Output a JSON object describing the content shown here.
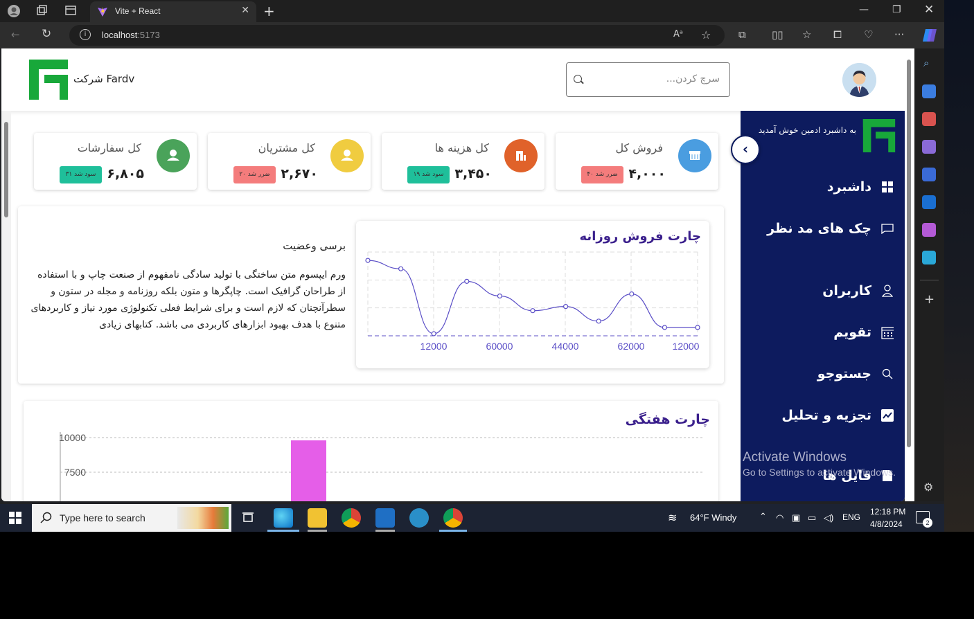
{
  "browser": {
    "tab_title": "Vite + React",
    "url_host": "localhost",
    "url_port": ":5173"
  },
  "header": {
    "company": "شرکت Fardv",
    "search_placeholder": "...سرچ کردن"
  },
  "sidebar": {
    "welcome": "به داشبرد ادمین خوش آمدید",
    "items": [
      {
        "label": "داشبرد",
        "icon": "grid-icon"
      },
      {
        "label": "چک های مد نظر",
        "icon": "chat-icon"
      },
      {
        "label": "کاربران",
        "icon": "user-icon"
      },
      {
        "label": "تقویم",
        "icon": "calendar-icon"
      },
      {
        "label": "جستوجو",
        "icon": "search-icon"
      },
      {
        "label": "تجزیه و تحلیل",
        "icon": "analytics-icon"
      },
      {
        "label": "فایل ها",
        "icon": "file-icon"
      }
    ]
  },
  "cards": [
    {
      "title": "فروش کل",
      "value": "۴,۰۰۰",
      "badge": "ضرر شد ۴۰",
      "badge_color": "#f47c7c",
      "icon_color": "#4a9de0",
      "icon": "shop-icon"
    },
    {
      "title": "کل هزینه ها",
      "value": "۳,۴۵۰",
      "badge": "سود شد ۱۹",
      "badge_color": "#1fbf9a",
      "icon_color": "#e0622a",
      "icon": "expense-icon"
    },
    {
      "title": "کل مشتریان",
      "value": "۲,۶۷۰",
      "badge": "ضرر شد ۲۰",
      "badge_color": "#f47c7c",
      "icon_color": "#f0cc40",
      "icon": "customer-icon"
    },
    {
      "title": "کل سفارشات",
      "value": "۶,۸۰۵",
      "badge": "سود شد ۳۱",
      "badge_color": "#1fbf9a",
      "icon_color": "#4aa35a",
      "icon": "order-icon"
    }
  ],
  "review": {
    "title": "برسی وعضیت",
    "text": "ورم ایپسوم متن ساختگی با تولید سادگی نامفهوم از صنعت چاپ و با استفاده از طراحان گرافیک است. چاپگرها و متون بلکه روزنامه و مجله در ستون و سطرآنچنان که لازم است و برای شرایط فعلی تکنولوژی مورد نیاز و کاربردهای متنوع با هدف بهبود ابزارهای کاربردی می باشد. کتابهای زیادی"
  },
  "chart_data": [
    {
      "type": "line",
      "title": "چارت فروش روزانه",
      "x": [
        "12000",
        "60000",
        "44000",
        "62000",
        "12000"
      ],
      "xlabel": "",
      "ylabel": "",
      "values": [
        72,
        64,
        2,
        52,
        38,
        24,
        28,
        14,
        40,
        8,
        8
      ],
      "grid": true,
      "color": "#5b4fc7"
    },
    {
      "type": "bar",
      "title": "چارت هفتگی",
      "y_ticks": [
        "10000",
        "7500"
      ],
      "ylim": [
        0,
        10000
      ],
      "bars": [
        {
          "value": 9800,
          "color": "#e55ee8"
        }
      ]
    }
  ],
  "windows_watermark": {
    "line1": "Activate Windows",
    "line2": "Go to Settings to activate Windows."
  },
  "taskbar": {
    "search_placeholder": "Type here to search",
    "weather": "64°F  Windy",
    "lang": "ENG",
    "time": "12:18 PM",
    "date": "4/8/2024",
    "notif_count": "2"
  }
}
